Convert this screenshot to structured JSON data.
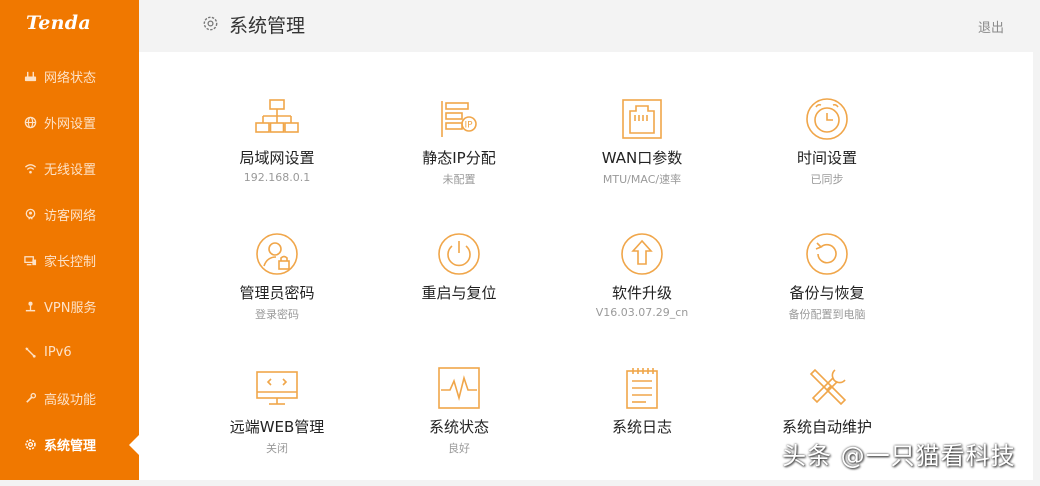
{
  "brand": {
    "logo": "Tenda",
    "accent": "#f07800"
  },
  "sidebar": {
    "items": [
      {
        "label": "网络状态",
        "icon": "router-icon"
      },
      {
        "label": "外网设置",
        "icon": "globe-icon"
      },
      {
        "label": "无线设置",
        "icon": "wifi-icon"
      },
      {
        "label": "访客网络",
        "icon": "guest-icon"
      },
      {
        "label": "家长控制",
        "icon": "parental-icon"
      },
      {
        "label": "VPN服务",
        "icon": "vpn-icon"
      },
      {
        "label": "IPv6",
        "icon": "ipv6-icon"
      },
      {
        "label": "高级功能",
        "icon": "wrench-icon"
      },
      {
        "label": "系统管理",
        "icon": "gear-icon",
        "active": true
      }
    ]
  },
  "header": {
    "title": "系统管理",
    "logout": "退出"
  },
  "tiles": [
    {
      "label": "局域网设置",
      "sub": "192.168.0.1",
      "icon": "lan-icon"
    },
    {
      "label": "静态IP分配",
      "sub": "未配置",
      "icon": "static-ip-icon"
    },
    {
      "label": "WAN口参数",
      "sub": "MTU/MAC/速率",
      "icon": "wan-port-icon"
    },
    {
      "label": "时间设置",
      "sub": "已同步",
      "icon": "clock-icon"
    },
    {
      "label": "管理员密码",
      "sub": "登录密码",
      "icon": "admin-password-icon"
    },
    {
      "label": "重启与复位",
      "sub": "",
      "icon": "power-icon"
    },
    {
      "label": "软件升级",
      "sub": "V16.03.07.29_cn",
      "icon": "upgrade-icon"
    },
    {
      "label": "备份与恢复",
      "sub": "备份配置到电脑",
      "icon": "backup-restore-icon"
    },
    {
      "label": "远端WEB管理",
      "sub": "关闭",
      "icon": "remote-web-icon"
    },
    {
      "label": "系统状态",
      "sub": "良好",
      "icon": "system-status-icon"
    },
    {
      "label": "系统日志",
      "sub": "",
      "icon": "system-log-icon"
    },
    {
      "label": "系统自动维护",
      "sub": "",
      "icon": "maintenance-icon"
    }
  ],
  "watermark": "头条 @一只猫看科技"
}
